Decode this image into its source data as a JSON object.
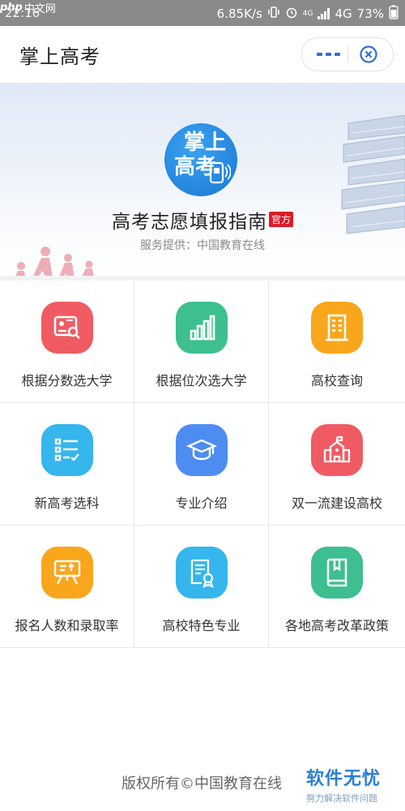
{
  "status_bar": {
    "time": "22:16",
    "watermark_logo": "php",
    "watermark_site": "中文网",
    "net_speed": "6.85K/s",
    "network": "4G",
    "small_network": "4G",
    "battery": "73%"
  },
  "header": {
    "title": "掌上高考",
    "more_icon": "more-dots-icon",
    "close_icon": "close-circle-icon"
  },
  "banner": {
    "logo_line1": "掌上",
    "logo_line2": "高考",
    "title": "高考志愿填报指南",
    "badge": "官方",
    "provider": "服务提供：中国教育在线"
  },
  "menu": [
    {
      "label": "根据分数选大学",
      "icon": "score-search-icon",
      "color": "#f05b63"
    },
    {
      "label": "根据位次选大学",
      "icon": "bar-chart-icon",
      "color": "#3dbf8f"
    },
    {
      "label": "高校查询",
      "icon": "building-icon",
      "color": "#f9a61c"
    },
    {
      "label": "新高考选科",
      "icon": "checklist-icon",
      "color": "#35b6ec"
    },
    {
      "label": "专业介绍",
      "icon": "graduation-cap-icon",
      "color": "#4d8df2"
    },
    {
      "label": "双一流建设高校",
      "icon": "school-building-icon",
      "color": "#f05b63"
    },
    {
      "label": "报名人数和录取率",
      "icon": "presentation-board-icon",
      "color": "#f9a61c"
    },
    {
      "label": "高校特色专业",
      "icon": "certificate-icon",
      "color": "#35b6ec"
    },
    {
      "label": "各地高考改革政策",
      "icon": "book-icon",
      "color": "#3dbf8f"
    }
  ],
  "footer": {
    "copyright": "版权所有©中国教育在线"
  },
  "watermark": {
    "brand": "软件无忧",
    "slogan": "努力解决软件问题"
  }
}
